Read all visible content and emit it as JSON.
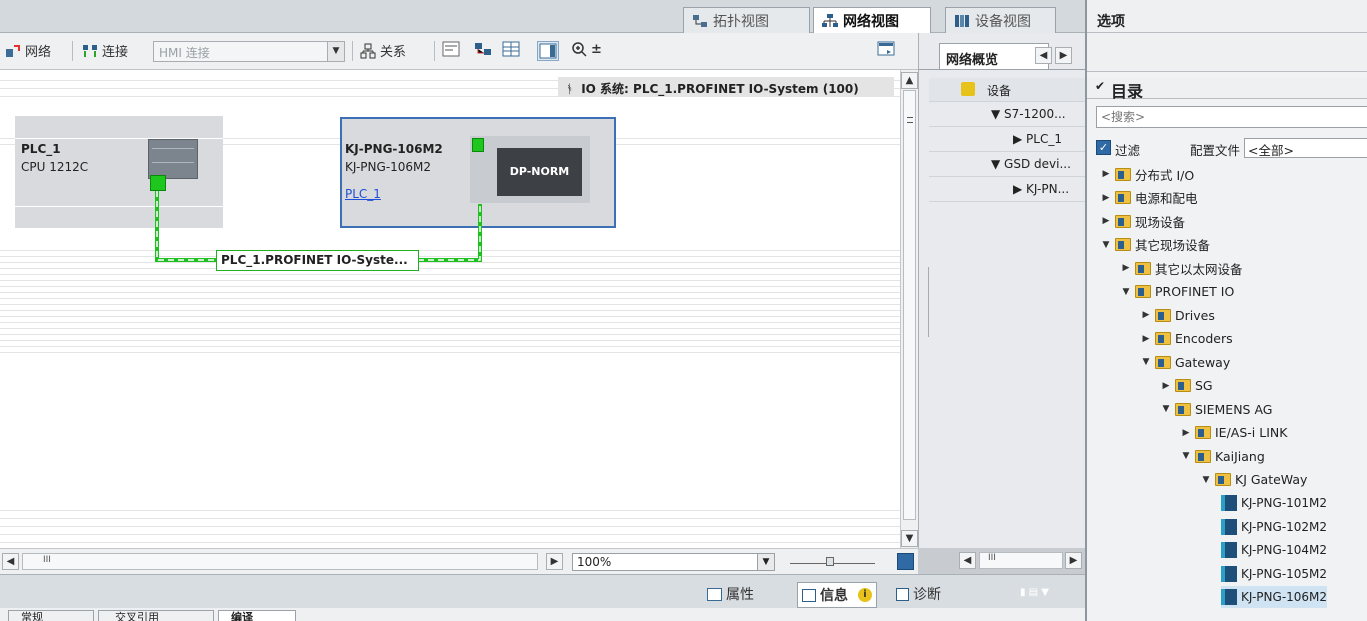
{
  "view_tabs": {
    "topology": "拓扑视图",
    "network": "网络视图",
    "device": "设备视图"
  },
  "toolbar": {
    "network": "网络",
    "connect": "连接",
    "hmi_combo": "HMI 连接",
    "relation": "关系",
    "zoom_in": "±"
  },
  "io_system_label": "IO 系统: PLC_1.PROFINET IO-System (100)",
  "devices": {
    "plc": {
      "name": "PLC_1",
      "type": "CPU 1212C"
    },
    "kj": {
      "name": "KJ-PNG-106M2",
      "type": "KJ-PNG-106M2",
      "link": "PLC_1",
      "module": "DP-NORM"
    }
  },
  "network_label": "PLC_1.PROFINET IO-Syste...",
  "zoom": "100%",
  "overview": {
    "tab": "网络概览",
    "header": "设备",
    "rows": [
      "S7-1200...",
      "PLC_1",
      "GSD devi...",
      "KJ-PN..."
    ]
  },
  "info_tabs": {
    "properties": "属性",
    "info": "信息",
    "diagnostics": "诊断"
  },
  "bottom_tabs": [
    "常规",
    "交叉引用",
    "编译"
  ],
  "right_panel": {
    "title": "选项",
    "catalog": "目录",
    "search_placeholder": "<搜索>",
    "filter": "过滤",
    "profile_label": "配置文件",
    "profile_value": "<全部>"
  },
  "tree": [
    {
      "label": "分布式 I/O",
      "level": 0,
      "expanded": false,
      "kind": "folder"
    },
    {
      "label": "电源和配电",
      "level": 0,
      "expanded": false,
      "kind": "folder"
    },
    {
      "label": "现场设备",
      "level": 0,
      "expanded": false,
      "kind": "folder"
    },
    {
      "label": "其它现场设备",
      "level": 0,
      "expanded": true,
      "kind": "folder"
    },
    {
      "label": "其它以太网设备",
      "level": 1,
      "expanded": false,
      "kind": "folder"
    },
    {
      "label": "PROFINET IO",
      "level": 1,
      "expanded": true,
      "kind": "folder"
    },
    {
      "label": "Drives",
      "level": 2,
      "expanded": false,
      "kind": "folder"
    },
    {
      "label": "Encoders",
      "level": 2,
      "expanded": false,
      "kind": "folder"
    },
    {
      "label": "Gateway",
      "level": 2,
      "expanded": true,
      "kind": "folder"
    },
    {
      "label": "SG",
      "level": 3,
      "expanded": false,
      "kind": "folder"
    },
    {
      "label": "SIEMENS AG",
      "level": 3,
      "expanded": true,
      "kind": "folder"
    },
    {
      "label": "IE/AS-i LINK",
      "level": 4,
      "expanded": false,
      "kind": "folder"
    },
    {
      "label": "KaiJiang",
      "level": 4,
      "expanded": true,
      "kind": "folder"
    },
    {
      "label": "KJ GateWay",
      "level": 5,
      "expanded": true,
      "kind": "folder"
    },
    {
      "label": "KJ-PNG-101M2",
      "level": 6,
      "kind": "module"
    },
    {
      "label": "KJ-PNG-102M2",
      "level": 6,
      "kind": "module"
    },
    {
      "label": "KJ-PNG-104M2",
      "level": 6,
      "kind": "module"
    },
    {
      "label": "KJ-PNG-105M2",
      "level": 6,
      "kind": "module"
    },
    {
      "label": "KJ-PNG-106M2",
      "level": 6,
      "kind": "module",
      "selected": true
    }
  ]
}
